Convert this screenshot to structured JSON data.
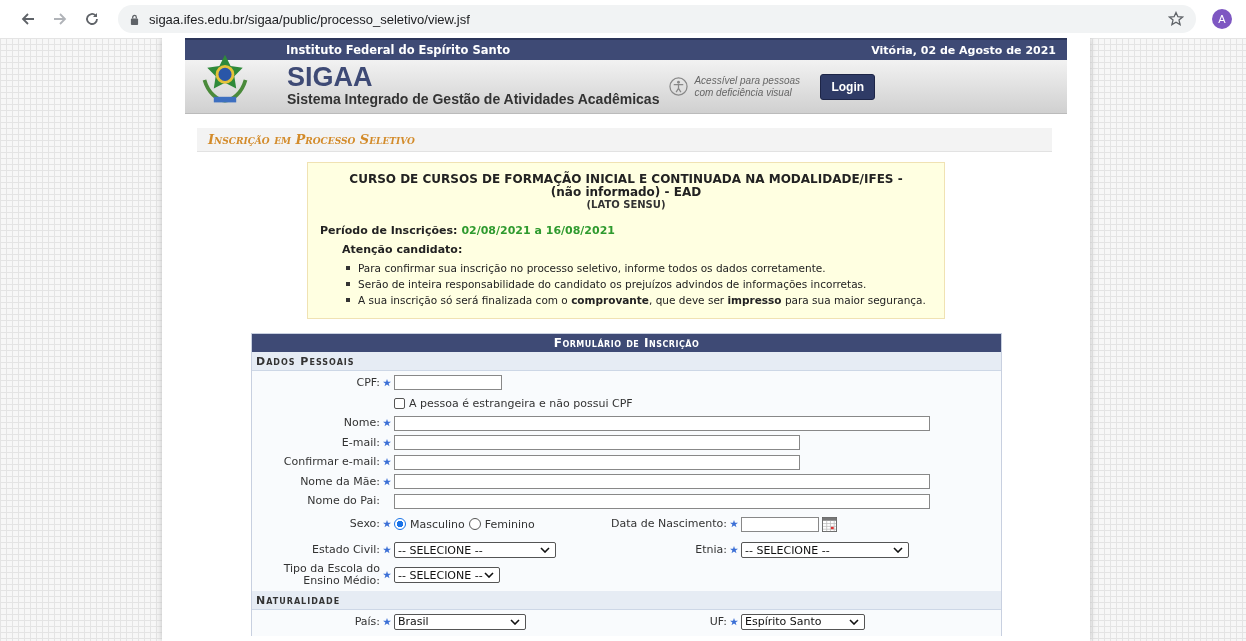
{
  "browser": {
    "url": "sigaa.ifes.edu.br/sigaa/public/processo_seletivo/view.jsf",
    "avatar": "A"
  },
  "header": {
    "institution": "Instituto Federal do Espírito Santo",
    "date": "Vitória, 02 de Agosto de 2021",
    "system": "SIGAA",
    "system_full": "Sistema Integrado de Gestão de Atividades Acadêmicas",
    "accessibility": "Acessível para pessoas com deficiência visual",
    "login": "Login"
  },
  "page_title": "Inscrição em Processo Seletivo",
  "notice": {
    "course": "CURSO DE CURSOS DE FORMAÇÃO INICIAL E CONTINUADA NA MODALIDADE/IFES - (não informado) - EAD",
    "level": "(LATO SENSU)",
    "period_label": "Período de Inscrições:",
    "period": "02/08/2021 a 16/08/2021",
    "attention": "Atenção candidato:",
    "items": [
      "Para confirmar sua inscrição no processo seletivo, informe todos os dados corretamente.",
      "Serão de inteira responsabilidade do candidato os prejuízos advindos de informações incorretas.",
      "A sua inscrição só será finalizada com o **comprovante**, que deve ser **impresso** para sua maior segurança."
    ]
  },
  "form": {
    "title": "Formulário de Inscrição",
    "sections": [
      {
        "title": "Dados Pessoais",
        "rows": [
          {
            "fields": [
              {
                "kind": "text",
                "label": "CPF:",
                "required": true
              }
            ]
          },
          {
            "fields": [
              {
                "kind": "checkbox",
                "label": "A pessoa é estrangeira e não possui CPF",
                "checked": false
              }
            ]
          },
          {
            "fields": [
              {
                "kind": "text",
                "label": "Nome:",
                "required": true
              }
            ]
          },
          {
            "fields": [
              {
                "kind": "text",
                "label": "E-mail:",
                "required": true
              }
            ]
          },
          {
            "fields": [
              {
                "kind": "text",
                "label": "Confirmar e-mail:",
                "required": true
              }
            ]
          },
          {
            "fields": [
              {
                "kind": "text",
                "label": "Nome da Mãe:",
                "required": true
              }
            ]
          },
          {
            "fields": [
              {
                "kind": "text",
                "label": "Nome do Pai:",
                "required": false
              }
            ]
          },
          {
            "fields": [
              {
                "kind": "radio",
                "label": "Sexo:",
                "required": true,
                "options": [
                  {
                    "label": "Masculino",
                    "selected": true
                  },
                  {
                    "label": "Feminino",
                    "selected": false
                  }
                ]
              },
              {
                "kind": "date",
                "label": "Data de Nascimento:",
                "required": true
              }
            ]
          },
          {
            "fields": [
              {
                "kind": "select",
                "label": "Estado Civil:",
                "required": true,
                "value": "-- SELECIONE --"
              },
              {
                "kind": "select",
                "label": "Etnia:",
                "required": true,
                "value": "-- SELECIONE --"
              }
            ]
          },
          {
            "fields": [
              {
                "kind": "select",
                "label": "Tipo da Escola do Ensino Médio:",
                "required": true,
                "value": "-- SELECIONE --"
              }
            ]
          }
        ]
      },
      {
        "title": "Naturalidade",
        "rows": [
          {
            "fields": [
              {
                "kind": "select",
                "label": "País:",
                "required": true,
                "value": "Brasil"
              },
              {
                "kind": "select",
                "label": "UF:",
                "required": true,
                "value": "Espírito Santo"
              }
            ]
          }
        ]
      }
    ]
  }
}
